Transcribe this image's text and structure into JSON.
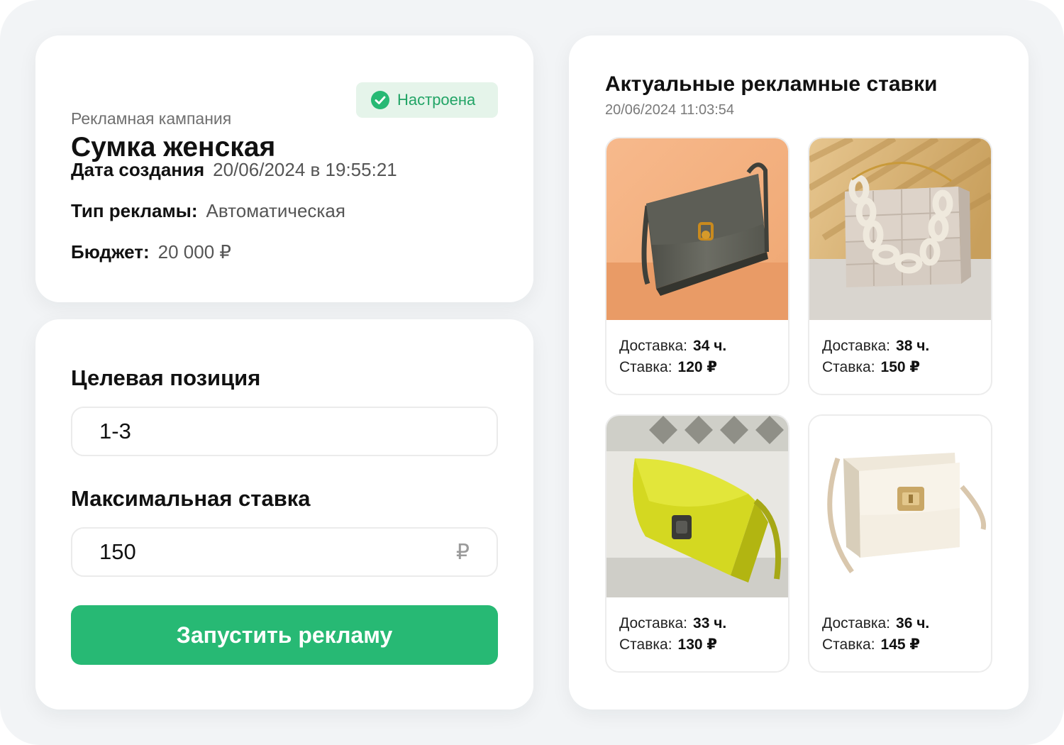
{
  "campaign": {
    "label": "Рекламная кампания",
    "title": "Сумка женская",
    "status": "Настроена",
    "created_label": "Дата создания",
    "created_value": "20/06/2024 в 19:55:21",
    "ad_type_label": "Тип рекламы:",
    "ad_type_value": "Автоматическая",
    "budget_label": "Бюджет:",
    "budget_value": "20 000 ₽"
  },
  "settings": {
    "target_position_label": "Целевая позиция",
    "target_position_value": "1-3",
    "max_bid_label": "Максимальная ставка",
    "max_bid_value": "150",
    "currency": "₽",
    "launch_button": "Запустить рекламу"
  },
  "bids": {
    "title": "Актуальные рекламные ставки",
    "timestamp": "20/06/2024 11:03:54",
    "delivery_label": "Доставка:",
    "bid_label": "Ставка:",
    "items": [
      {
        "delivery": "34 ч.",
        "bid": "120 ₽"
      },
      {
        "delivery": "38 ч.",
        "bid": "150 ₽"
      },
      {
        "delivery": "33 ч.",
        "bid": "130 ₽"
      },
      {
        "delivery": "36 ч.",
        "bid": "145 ₽"
      }
    ]
  },
  "colors": {
    "accent_green": "#27b974",
    "status_bg": "#e5f4ea",
    "status_text": "#22a466",
    "page_bg": "#f2f4f6"
  }
}
